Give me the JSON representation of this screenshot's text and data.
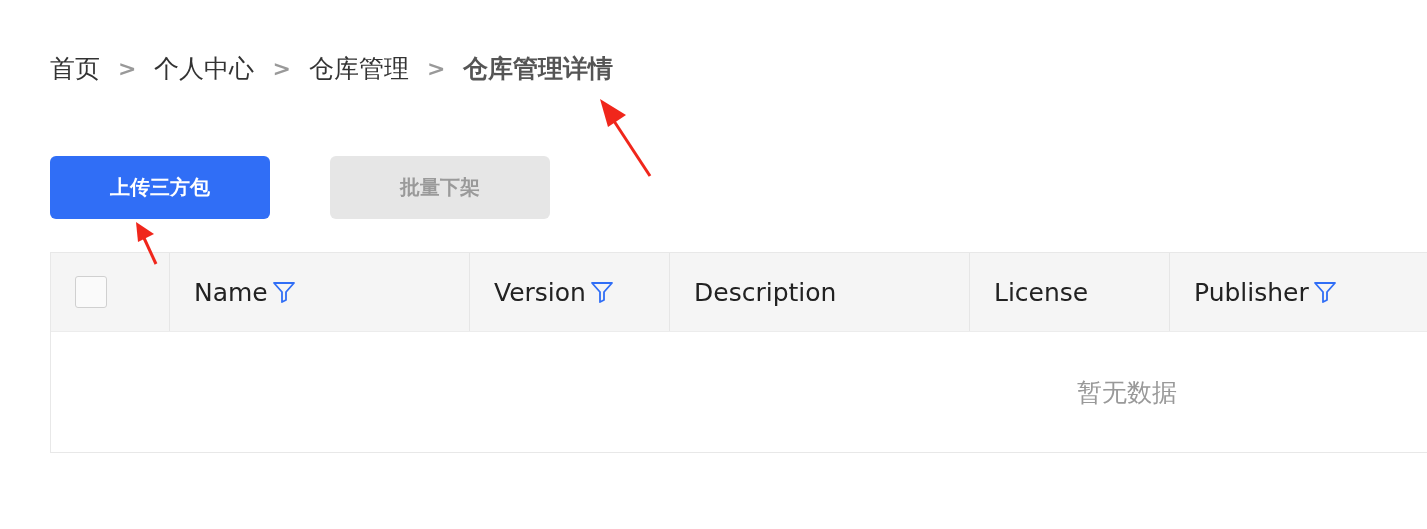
{
  "breadcrumb": [
    {
      "label": "首页",
      "current": false
    },
    {
      "label": "个人中心",
      "current": false
    },
    {
      "label": "仓库管理",
      "current": false
    },
    {
      "label": "仓库管理详情",
      "current": true
    }
  ],
  "separator": ">",
  "buttons": [
    {
      "label": "上传三方包",
      "disabled": false
    },
    {
      "label": "批量下架",
      "disabled": true
    }
  ],
  "table": {
    "select_all": {
      "checked": false
    },
    "columns": [
      {
        "label": "Name",
        "filterable": true
      },
      {
        "label": "Version",
        "filterable": true
      },
      {
        "label": "Description",
        "filterable": false
      },
      {
        "label": "License",
        "filterable": false
      },
      {
        "label": "Publisher",
        "filterable": true
      }
    ],
    "empty_text": "暂无数据"
  }
}
